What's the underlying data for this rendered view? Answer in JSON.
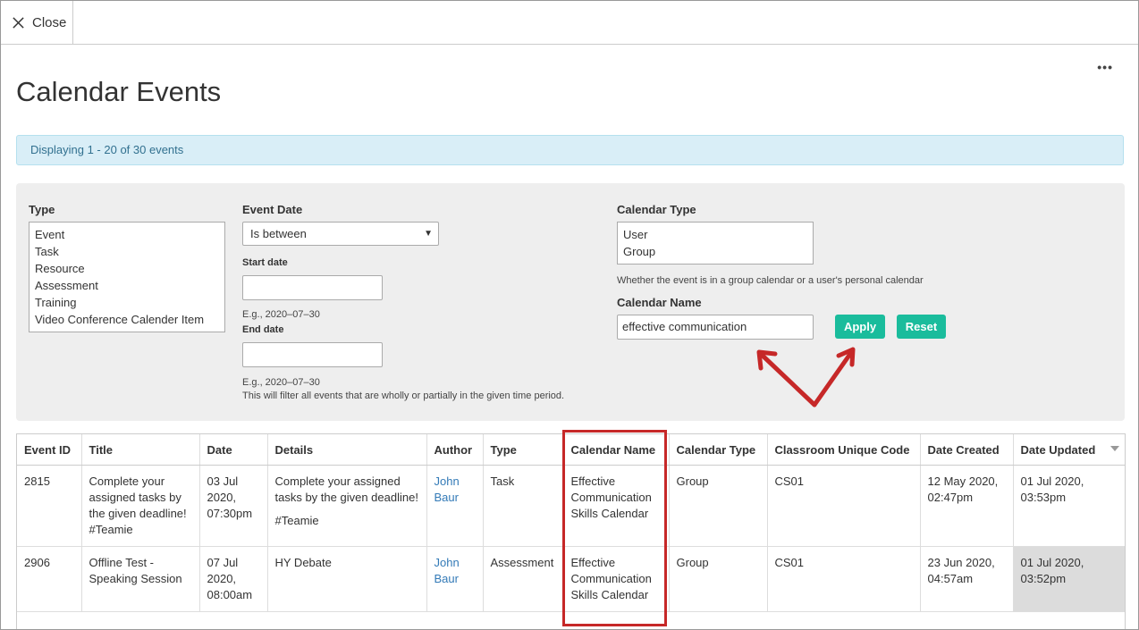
{
  "topbar": {
    "close_label": "Close"
  },
  "page": {
    "title": "Calendar Events"
  },
  "banner": {
    "text": "Displaying 1 - 20 of 30 events"
  },
  "filters": {
    "type": {
      "label": "Type",
      "options": [
        "Event",
        "Task",
        "Resource",
        "Assessment",
        "Training",
        "Video Conference Calender Item"
      ]
    },
    "event_date": {
      "label": "Event Date",
      "selected": "Is between",
      "start_label": "Start date",
      "start_value": "",
      "start_hint": "E.g., 2020–07–30",
      "end_label": "End date",
      "end_value": "",
      "end_hint": "E.g., 2020–07–30",
      "period_hint": "This will filter all events that are wholly or partially in the given time period."
    },
    "calendar_type": {
      "label": "Calendar Type",
      "options": [
        "User",
        "Group"
      ],
      "hint": "Whether the event is in a group calendar or a user's personal calendar"
    },
    "calendar_name": {
      "label": "Calendar Name",
      "value": "effective communication"
    },
    "apply_label": "Apply",
    "reset_label": "Reset"
  },
  "table": {
    "headers": [
      "Event ID",
      "Title",
      "Date",
      "Details",
      "Author",
      "Type",
      "Calendar Name",
      "Calendar Type",
      "Classroom Unique Code",
      "Date Created",
      "Date Updated"
    ],
    "rows": [
      {
        "id": "2815",
        "title": "Complete your assigned tasks by the given deadline! #Teamie",
        "date": "03 Jul 2020, 07:30pm",
        "details": "Complete your assigned tasks by the given deadline!",
        "details_extra": "#Teamie",
        "author": "John Baur",
        "type": "Task",
        "calendar_name": "Effective Communication Skills Calendar",
        "calendar_type": "Group",
        "code": "CS01",
        "created": "12 May 2020, 02:47pm",
        "updated": "01 Jul 2020, 03:53pm"
      },
      {
        "id": "2906",
        "title": "Offline Test - Speaking Session",
        "date": "07 Jul 2020, 08:00am",
        "details": "HY Debate",
        "details_extra": "",
        "author": "John Baur",
        "type": "Assessment",
        "calendar_name": "Effective Communication Skills Calendar",
        "calendar_type": "Group",
        "code": "CS01",
        "created": "23 Jun 2020, 04:57am",
        "updated": "01 Jul 2020, 03:52pm"
      }
    ]
  },
  "colors": {
    "accent": "#1abc9c",
    "annotation": "#c62828",
    "link": "#337ab7",
    "banner_bg": "#d9eef7"
  },
  "icons": {
    "close": "close-icon",
    "more": "more-icon",
    "sort": "sort-desc-icon"
  }
}
